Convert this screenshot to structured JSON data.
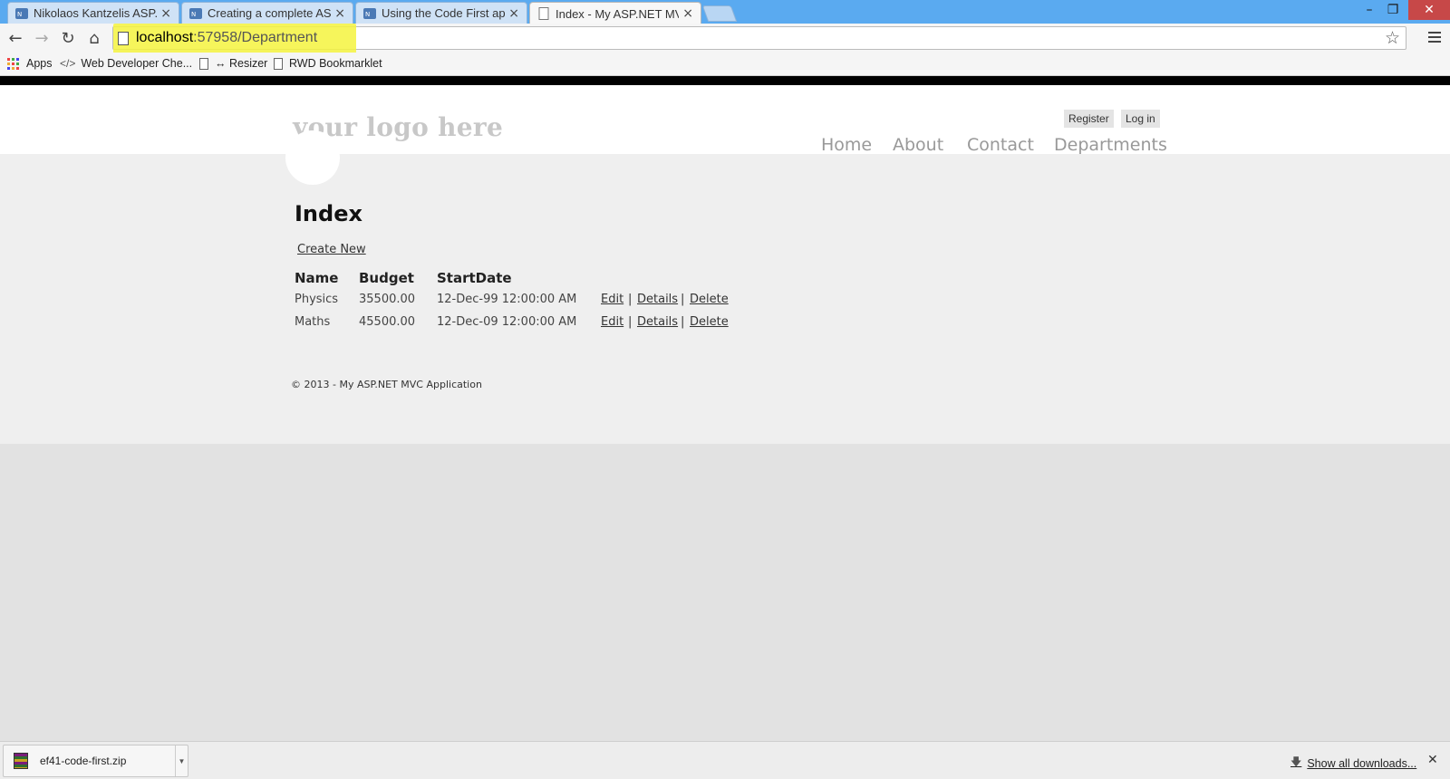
{
  "browser": {
    "tabs": [
      {
        "label": "Nikolaos Kantzelis ASP.Ne",
        "active": false
      },
      {
        "label": "Creating a complete ASP.N",
        "active": false
      },
      {
        "label": "Using the Code First appro",
        "active": false
      },
      {
        "label": "Index - My ASP.NET MVC",
        "active": true
      }
    ],
    "tab_close_glyph": "×",
    "window_controls": {
      "minimize": "–",
      "restore": "❐",
      "close": "✕"
    },
    "nav": {
      "back": "←",
      "forward": "→",
      "reload": "↻",
      "home": "⌂"
    },
    "address": {
      "host": "localhost",
      "path": ":57958/Department"
    },
    "star_glyph": "☆",
    "bookmarks": [
      {
        "label": "Apps",
        "icon": "apps-grid-icon"
      },
      {
        "label": "Web Developer Che...",
        "icon": "code-icon",
        "glyph": "</>"
      },
      {
        "label": "↔ Resizer",
        "icon": "page-icon"
      },
      {
        "label": "RWD Bookmarklet",
        "icon": "page-icon"
      }
    ],
    "colors": {
      "titlebar": "#5aaaf0",
      "highlight": "#f4f33e",
      "close_button": "#c74848"
    }
  },
  "site": {
    "logo": "your logo here",
    "account": {
      "register": "Register",
      "login": "Log in"
    },
    "nav": [
      "Home",
      "About",
      "Contact",
      "Departments"
    ],
    "page_title": "Index",
    "create_link": "Create New",
    "table": {
      "headers": [
        "Name",
        "Budget",
        "StartDate"
      ],
      "rows": [
        {
          "name": "Physics",
          "budget": "35500.00",
          "start": "12-Dec-99 12:00:00 AM"
        },
        {
          "name": "Maths",
          "budget": "45500.00",
          "start": "12-Dec-09 12:00:00 AM"
        }
      ],
      "actions": [
        "Edit",
        "Details",
        "Delete"
      ],
      "separator": "|"
    },
    "footer": "© 2013 - My ASP.NET MVC Application"
  },
  "downloads": {
    "file": "ef41-code-first.zip",
    "dropdown_glyph": "▼",
    "show_all": "Show all downloads...",
    "arrow_glyph": "🡇",
    "close_glyph": "✕"
  }
}
